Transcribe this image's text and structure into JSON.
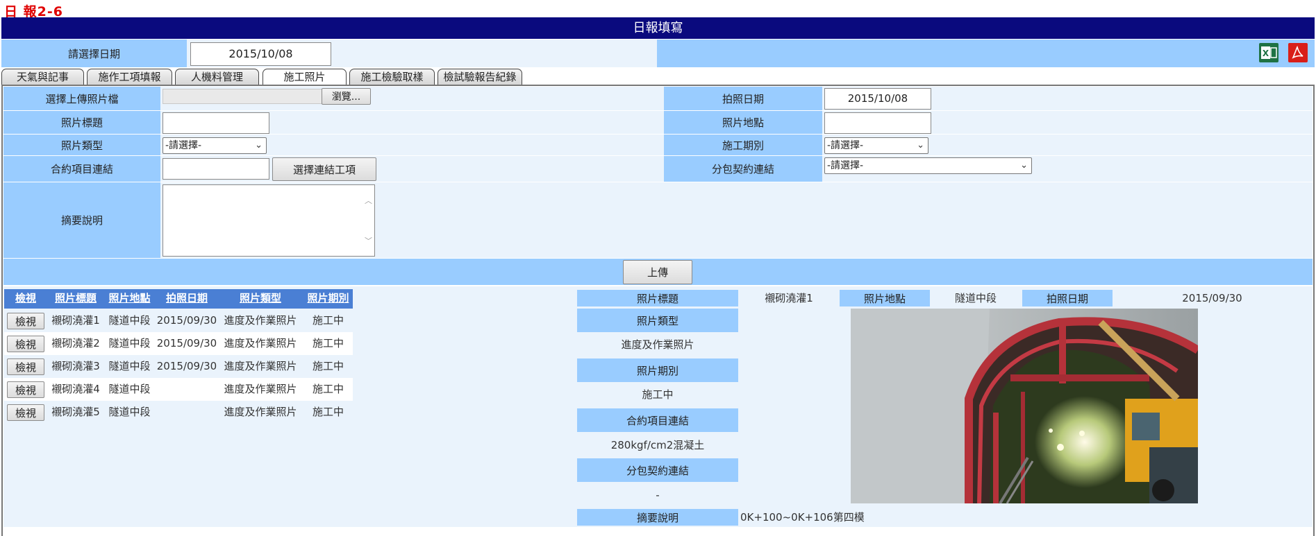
{
  "page_label": "日 報2-6",
  "title": "日報填寫",
  "date_select": {
    "label": "請選擇日期",
    "value": "2015/10/08"
  },
  "export_icons": [
    "excel-icon",
    "pdf-icon"
  ],
  "tabs": [
    {
      "label": "天氣與記事"
    },
    {
      "label": "施作工項填報"
    },
    {
      "label": "人機料管理"
    },
    {
      "label": "施工照片",
      "active": true
    },
    {
      "label": "施工檢驗取樣"
    },
    {
      "label": "檢試驗報告紀錄"
    }
  ],
  "form": {
    "upload_label": "選擇上傳照片檔",
    "browse_button": "瀏覽...",
    "photo_date_label": "拍照日期",
    "photo_date_value": "2015/10/08",
    "photo_title_label": "照片標題",
    "photo_title_value": "",
    "photo_location_label": "照片地點",
    "photo_location_value": "",
    "photo_type_label": "照片類型",
    "photo_type_selected": "-請選擇-",
    "phase_label": "施工期別",
    "phase_selected": "-請選擇-",
    "contract_link_label": "合約項目連結",
    "contract_link_value": "",
    "select_link_button": "選擇連結工項",
    "subcontract_label": "分包契約連結",
    "subcontract_selected": "-請選擇-",
    "summary_label": "摘要說明",
    "summary_value": "",
    "upload_button": "上傳"
  },
  "table": {
    "headers": [
      "檢視",
      "照片標題",
      "照片地點",
      "拍照日期",
      "照片類型",
      "照片期別"
    ],
    "view_button": "檢視",
    "rows": [
      {
        "title": "襯砌澆灌1",
        "location": "隧道中段",
        "date": "2015/09/30",
        "type": "進度及作業照片",
        "phase": "施工中"
      },
      {
        "title": "襯砌澆灌2",
        "location": "隧道中段",
        "date": "2015/09/30",
        "type": "進度及作業照片",
        "phase": "施工中"
      },
      {
        "title": "襯砌澆灌3",
        "location": "隧道中段",
        "date": "2015/09/30",
        "type": "進度及作業照片",
        "phase": "施工中"
      },
      {
        "title": "襯砌澆灌4",
        "location": "隧道中段",
        "date": "",
        "type": "進度及作業照片",
        "phase": "施工中"
      },
      {
        "title": "襯砌澆灌5",
        "location": "隧道中段",
        "date": "",
        "type": "進度及作業照片",
        "phase": "施工中"
      }
    ]
  },
  "detail": {
    "title_label": "照片標題",
    "title_value": "襯砌澆灌1",
    "location_label": "照片地點",
    "location_value": "隧道中段",
    "date_label": "拍照日期",
    "date_value": "2015/09/30",
    "type_label": "照片類型",
    "type_value": "進度及作業照片",
    "phase_label": "照片期別",
    "phase_value": "施工中",
    "contract_label": "合約項目連結",
    "contract_value": "280kgf/cm2混凝土",
    "subcontract_label": "分包契約連結",
    "subcontract_value": "-",
    "summary_label": "摘要說明",
    "summary_value": "0K+100~0K+106第四模"
  },
  "colors": {
    "title_bar": "#0a0a7e",
    "label_bg": "#99ccff",
    "light_bg": "#eaf3fc",
    "table_header": "#4a7fd4",
    "page_label": "#e00000"
  }
}
